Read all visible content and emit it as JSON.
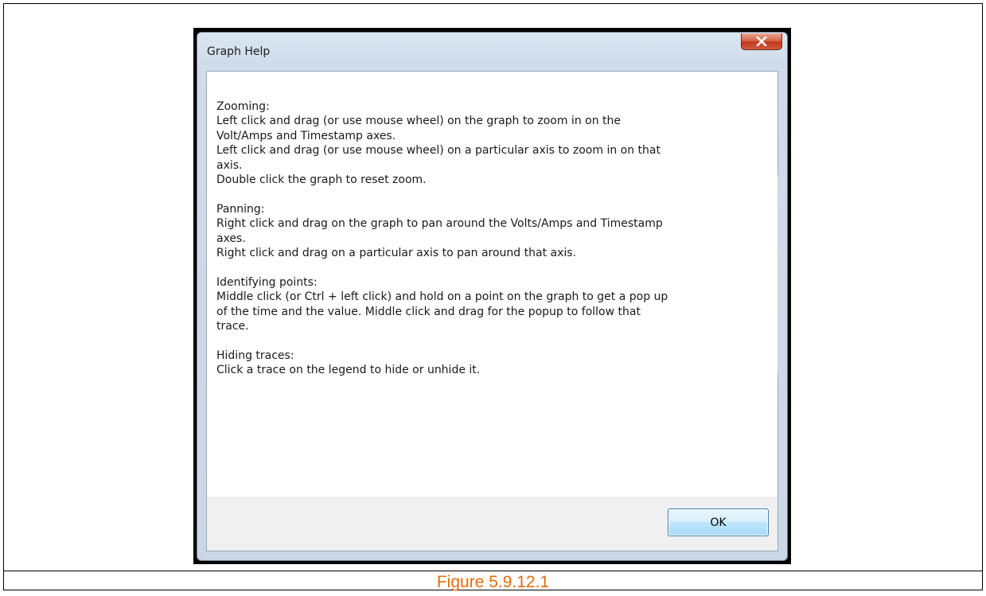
{
  "dialog": {
    "title": "Graph Help",
    "close_icon": "close-x-icon",
    "ok_label": "OK"
  },
  "help": {
    "zooming": {
      "heading": "Zooming:",
      "lines": [
        "Left click and drag (or use mouse wheel) on the graph to zoom in on the",
        "Volt/Amps and Timestamp axes.",
        "Left click and drag (or use mouse wheel) on a particular axis to zoom in on that",
        "axis.",
        "Double click the graph to reset zoom."
      ]
    },
    "panning": {
      "heading": "Panning:",
      "lines": [
        "Right click and drag on the graph to pan around the Volts/Amps and Timestamp",
        "axes.",
        "Right click and drag on a particular axis to pan around that axis."
      ]
    },
    "identifying": {
      "heading": "Identifying points:",
      "lines": [
        "Middle click (or Ctrl + left click) and hold on a point on the graph to get a pop up",
        "of the time and the value. Middle click and drag for the popup to follow that",
        "trace."
      ]
    },
    "hiding": {
      "heading": "Hiding traces:",
      "lines": [
        "Click a trace on the legend to hide or unhide it."
      ]
    }
  },
  "caption": "Figure 5.9.12.1",
  "colors": {
    "caption": "#e46c0a",
    "close_button": "#c13a1f",
    "ok_border": "#3c7fb1"
  }
}
